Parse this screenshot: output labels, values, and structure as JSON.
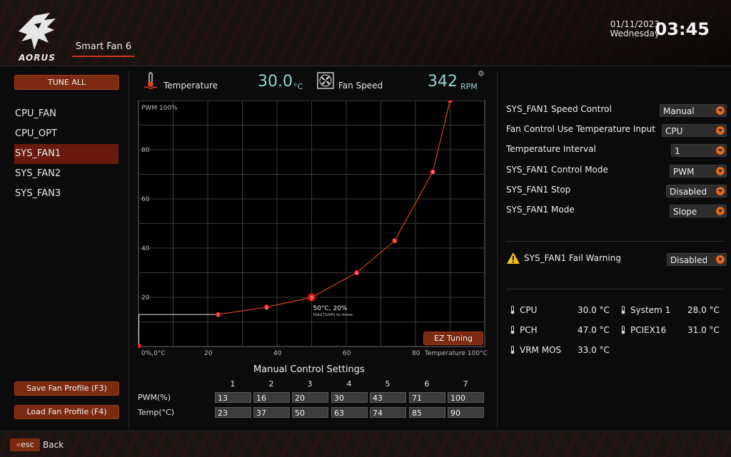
{
  "header": {
    "brand": "AORUS",
    "page_tab": "Smart Fan 6",
    "date": "01/11/2023",
    "weekday": "Wednesday",
    "time": "03:45"
  },
  "sidebar": {
    "tune_all": "TUNE ALL",
    "fans": [
      {
        "label": "CPU_FAN",
        "selected": false
      },
      {
        "label": "CPU_OPT",
        "selected": false
      },
      {
        "label": "SYS_FAN1",
        "selected": true
      },
      {
        "label": "SYS_FAN2",
        "selected": false
      },
      {
        "label": "SYS_FAN3",
        "selected": false
      }
    ],
    "save_profile": "Save Fan Profile (F3)",
    "load_profile": "Load Fan Profile (F4)"
  },
  "status": {
    "temperature_label": "Temperature",
    "temperature_value": "30.0",
    "temperature_unit": "°C",
    "fan_speed_label": "Fan Speed",
    "fan_speed_value": "342",
    "fan_speed_unit": "RPM"
  },
  "chart_data": {
    "type": "line",
    "y_top_label": "PWM 100%",
    "x_end_label": "Temperature 100°C",
    "origin_label": "0%,0°C",
    "xticks": [
      20,
      40,
      60,
      80
    ],
    "yticks": [
      20,
      40,
      60,
      80
    ],
    "xlim": [
      0,
      100
    ],
    "ylim": [
      0,
      100
    ],
    "grid": true,
    "points": [
      {
        "n": 1,
        "temp": 23,
        "pwm": 13
      },
      {
        "n": 2,
        "temp": 37,
        "pwm": 16
      },
      {
        "n": 3,
        "temp": 50,
        "pwm": 20
      },
      {
        "n": 4,
        "temp": 63,
        "pwm": 30
      },
      {
        "n": 5,
        "temp": 74,
        "pwm": 43
      },
      {
        "n": 6,
        "temp": 85,
        "pwm": 71
      },
      {
        "n": 7,
        "temp": 90,
        "pwm": 100
      }
    ],
    "current_point": {
      "temp": 0,
      "pwm": 0
    },
    "tooltip": "50°C, 20%",
    "tooltip_hint": "Hold [Shift] to move",
    "line_color": "#d8431c",
    "point_color": "#e02020"
  },
  "ez_tuning": "EZ Tuning",
  "manual": {
    "title": "Manual Control Settings",
    "columns": [
      "1",
      "2",
      "3",
      "4",
      "5",
      "6",
      "7"
    ],
    "pwm_label": "PWM(%)",
    "temp_label": "Temp(°C)",
    "pwm": [
      "13",
      "16",
      "20",
      "30",
      "43",
      "71",
      "100"
    ],
    "temp": [
      "23",
      "37",
      "50",
      "63",
      "74",
      "85",
      "90"
    ]
  },
  "settings": [
    {
      "label": "SYS_FAN1 Speed Control",
      "value": "Manual"
    },
    {
      "label": "Fan Control Use Temperature Input",
      "value": "CPU"
    },
    {
      "label": "Temperature Interval",
      "value": "1"
    },
    {
      "label": "SYS_FAN1 Control Mode",
      "value": "PWM"
    },
    {
      "label": "SYS_FAN1 Stop",
      "value": "Disabled"
    },
    {
      "label": "SYS_FAN1 Mode",
      "value": "Slope"
    }
  ],
  "fail_warning": {
    "label": "SYS_FAN1 Fail Warning",
    "value": "Disabled"
  },
  "temps": [
    {
      "label": "CPU",
      "value": "30.0 °C"
    },
    {
      "label": "System 1",
      "value": "28.0 °C"
    },
    {
      "label": "PCH",
      "value": "47.0 °C"
    },
    {
      "label": "PCIEX16",
      "value": "31.0 °C"
    },
    {
      "label": "VRM MOS",
      "value": "33.0 °C"
    }
  ],
  "footer": {
    "esc": "esc",
    "back": "Back"
  },
  "colors": {
    "accent": "#7d2a12",
    "cyan": "#8fd6d2",
    "selected": "#6a1a0c"
  }
}
